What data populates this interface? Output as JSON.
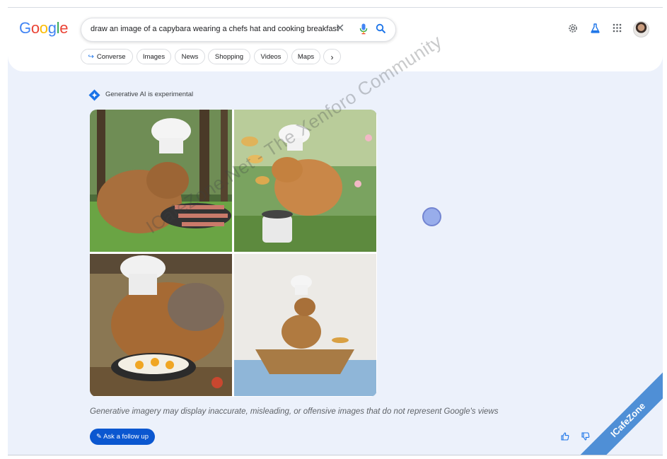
{
  "header": {
    "logo_letters": [
      {
        "ch": "G",
        "color": "#4285f4"
      },
      {
        "ch": "o",
        "color": "#ea4335"
      },
      {
        "ch": "o",
        "color": "#fbbc05"
      },
      {
        "ch": "g",
        "color": "#4285f4"
      },
      {
        "ch": "l",
        "color": "#34a853"
      },
      {
        "ch": "e",
        "color": "#ea4335"
      }
    ],
    "search": {
      "query": "draw an image of a capybara wearing a chefs hat and cooking breakfast",
      "clear_icon": "close-icon",
      "mic_icon": "mic-icon",
      "search_icon": "search-icon"
    },
    "icons": [
      "settings-icon",
      "labs-flask-icon",
      "apps-grid-icon",
      "avatar"
    ]
  },
  "chips": [
    {
      "label": "Converse",
      "icon": "converse-arrow-icon"
    },
    {
      "label": "Images"
    },
    {
      "label": "News"
    },
    {
      "label": "Shopping"
    },
    {
      "label": "Videos"
    },
    {
      "label": "Maps"
    }
  ],
  "chips_more_icon": "chevron-right-icon",
  "generative": {
    "label": "Generative AI is experimental",
    "images": [
      {
        "desc_icon": "capybara-grill-image"
      },
      {
        "desc_icon": "capybara-pancakes-image"
      },
      {
        "desc_icon": "capybara-frying-pan-image"
      },
      {
        "desc_icon": "capybara-boat-image"
      }
    ],
    "disclaimer": "Generative imagery may display inaccurate, misleading, or offensive images that do not represent Google's views",
    "follow_up_label": "Ask a follow up"
  },
  "feedback": {
    "up_icon": "thumbs-up-icon",
    "down_icon": "thumbs-down-icon"
  },
  "watermark": "ICafeZone.Net - The Xenforo Community",
  "corner_badge": "ICafeZone",
  "colors": {
    "accent": "#0b57d0",
    "page_bg": "#ecf1fb"
  }
}
